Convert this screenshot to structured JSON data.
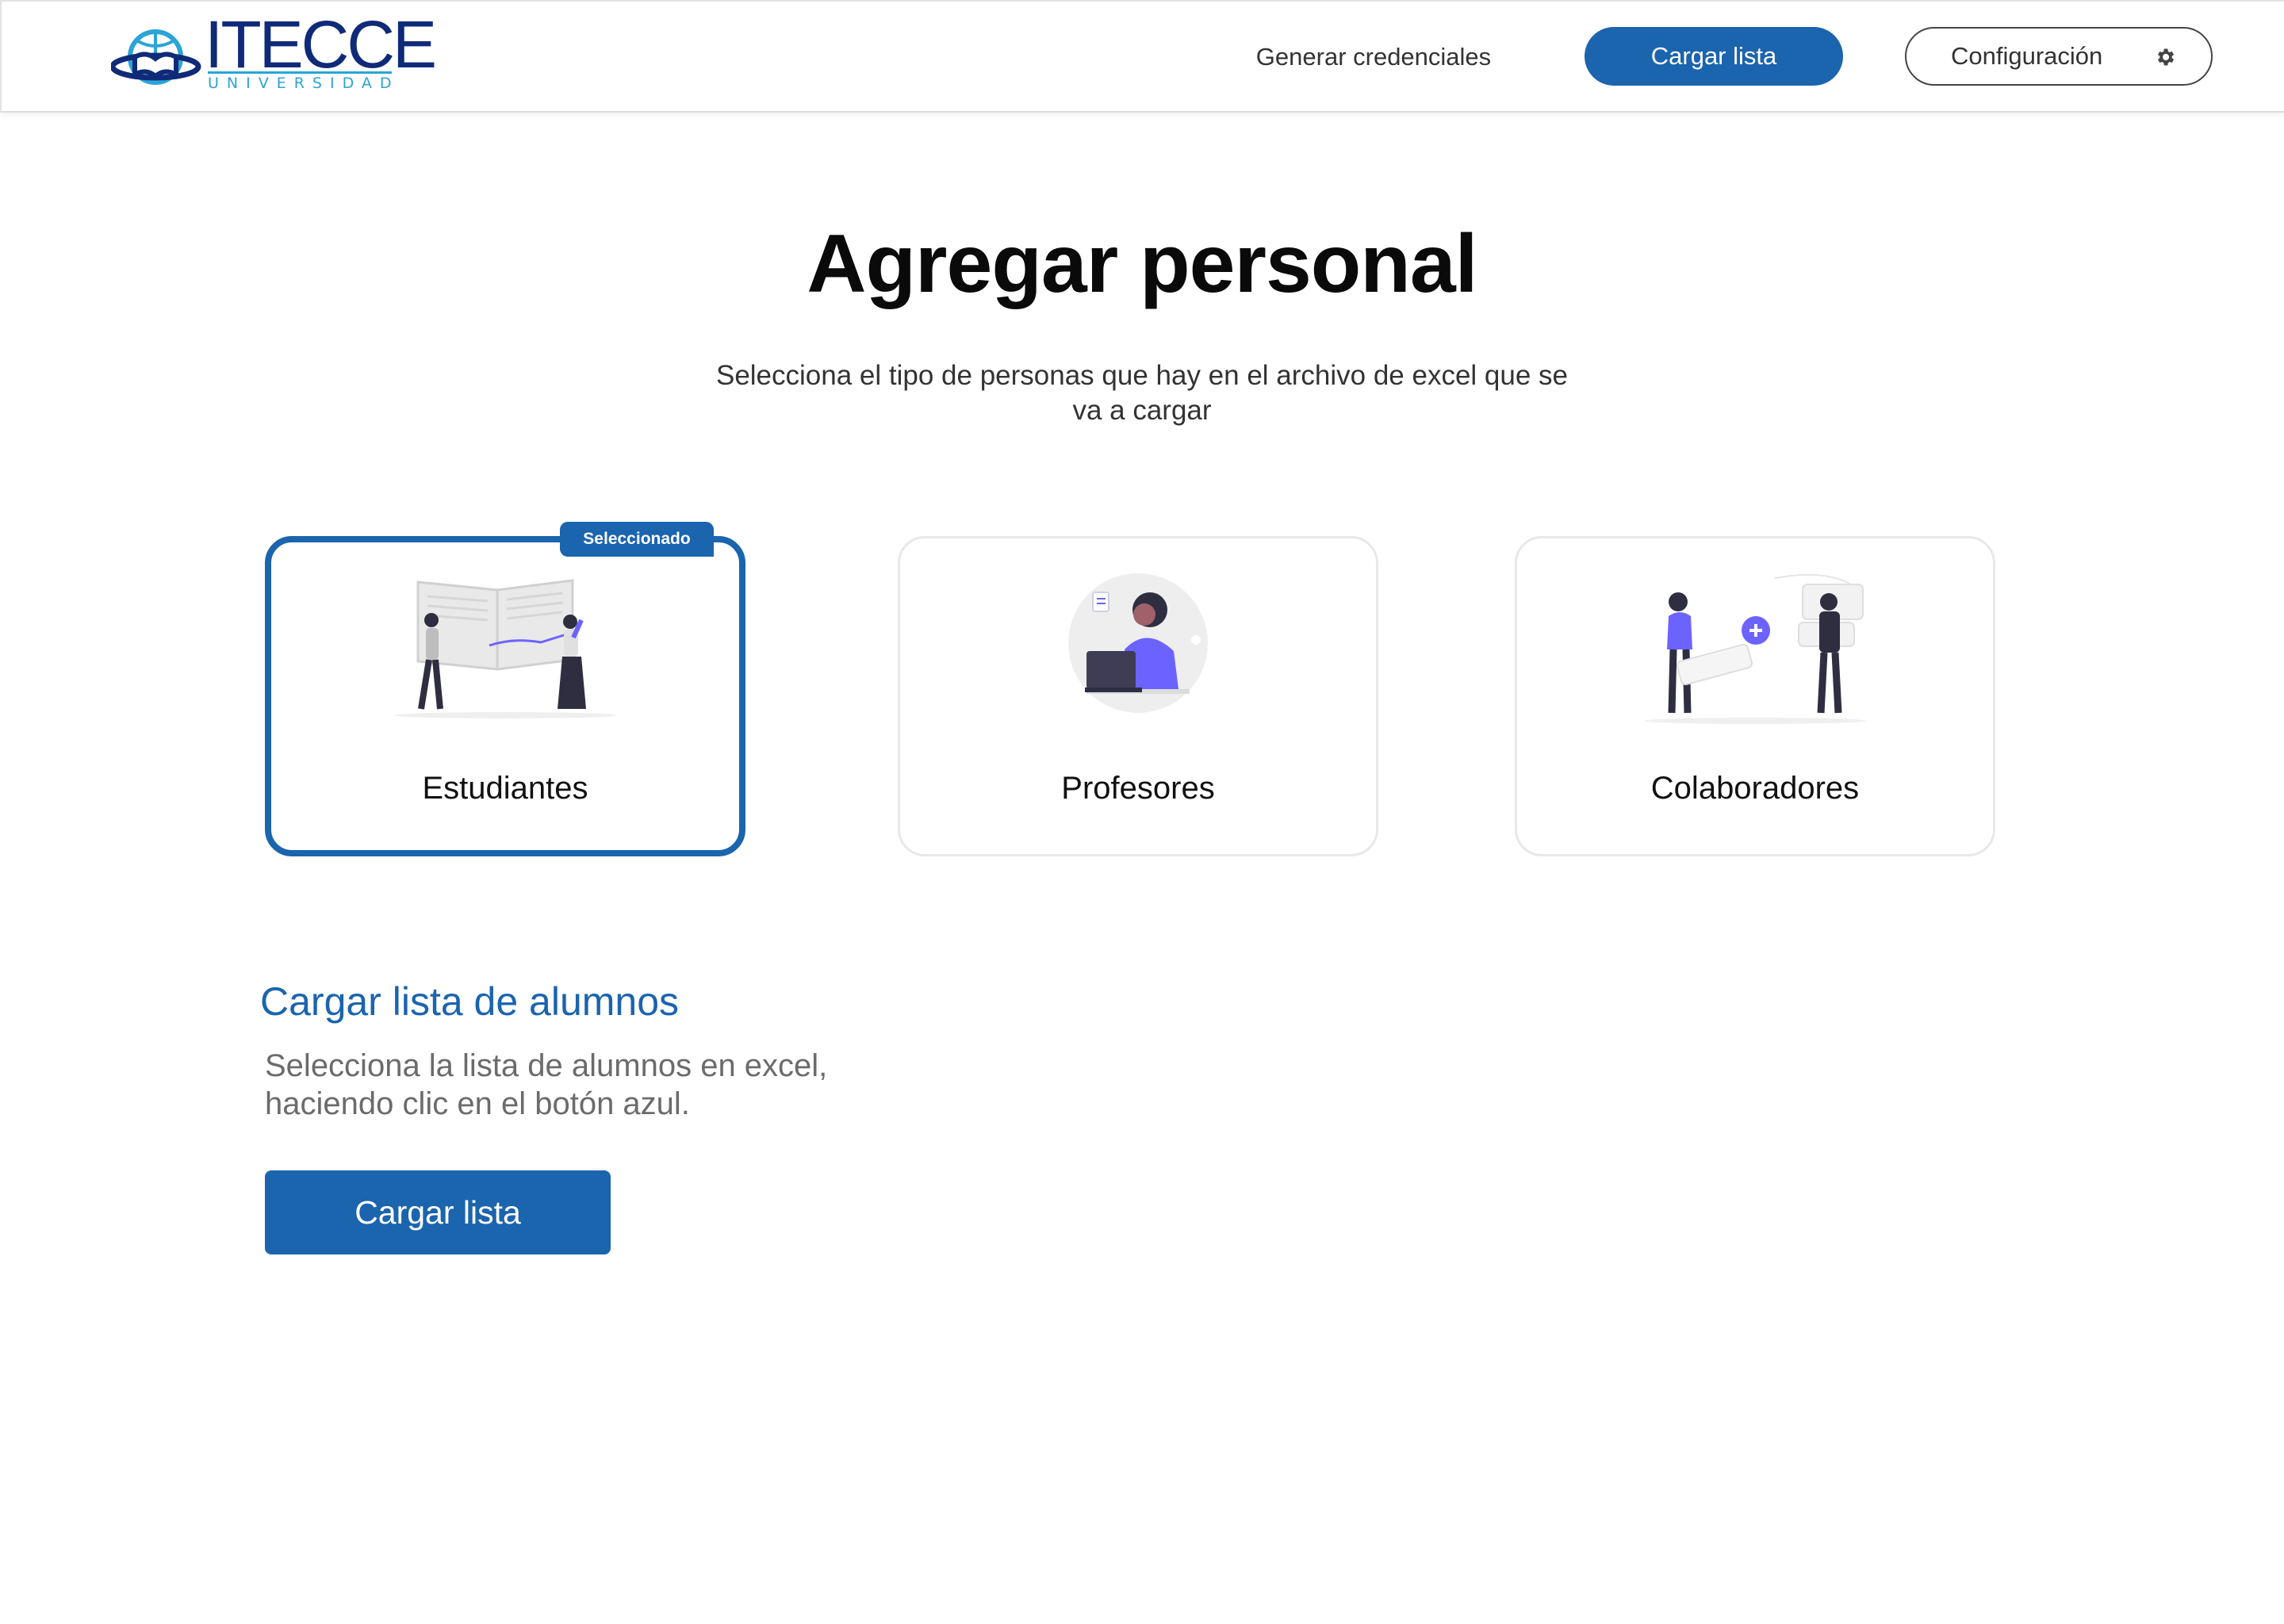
{
  "header": {
    "brand_name": "ITECCE",
    "brand_subtitle": "UNIVERSIDAD",
    "nav_link": "Generar credenciales",
    "primary_button": "Cargar lista",
    "settings_button": "Configuración",
    "settings_icon": "gear-icon"
  },
  "hero": {
    "title": "Agregar personal",
    "subtitle": "Selecciona el tipo de personas que hay en el archivo de excel que se va a cargar"
  },
  "cards": [
    {
      "label": "Estudiantes",
      "selected": true,
      "badge": "Seleccionado",
      "illustration": "students-illustration"
    },
    {
      "label": "Profesores",
      "selected": false,
      "illustration": "teacher-illustration"
    },
    {
      "label": "Colaboradores",
      "selected": false,
      "illustration": "collaborators-illustration"
    }
  ],
  "upload": {
    "title": "Cargar lista de alumnos",
    "description": "Selecciona la lista de alumnos en excel, haciendo clic en el botón azul.",
    "button": "Cargar lista"
  },
  "colors": {
    "primary": "#1b64ae",
    "illustration_accent": "#6c63ff",
    "brand_navy": "#0f2a78",
    "brand_cyan": "#2ba4d6"
  }
}
